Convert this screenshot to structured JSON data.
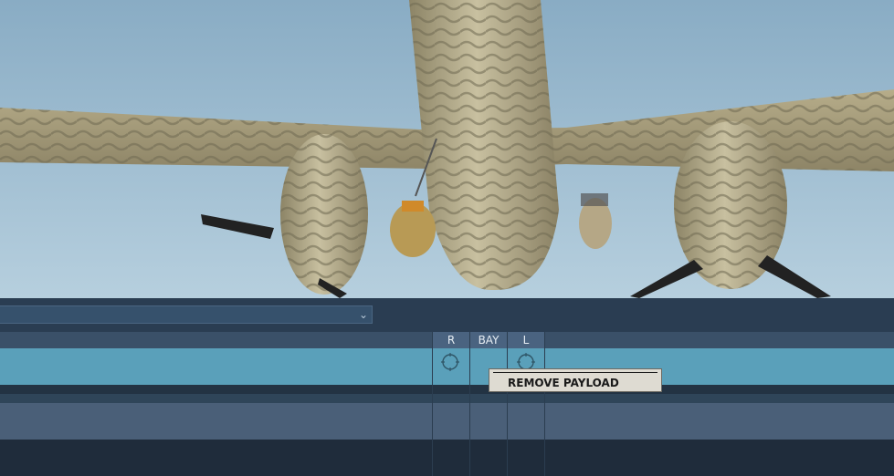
{
  "scene": {
    "sky_color": "#8fb4cc",
    "aircraft_camo": "#a49a78"
  },
  "toolbar": {
    "dropdown_value": ""
  },
  "loadout_table": {
    "columns": [
      {
        "label": "R"
      },
      {
        "label": "BAY"
      },
      {
        "label": "L"
      }
    ],
    "selected_row_color": "#5aa0ba"
  },
  "context_menu": {
    "item_label": "REMOVE PAYLOAD"
  }
}
